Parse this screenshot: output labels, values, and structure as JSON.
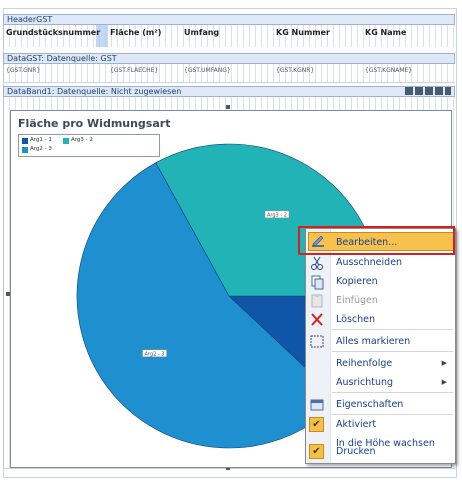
{
  "header_band": {
    "title": "HeaderGST",
    "columns": [
      "Grundstücksnummer",
      "Fläche (m²)",
      "Umfang",
      "KG Nummer",
      "KG Name"
    ]
  },
  "data_band": {
    "title": "DataGST: Datenquelle: GST",
    "fields": [
      "{GST.GNR}",
      "{GST.FLAECHE}",
      "{GST.UMFANG}",
      "{GST.KGNR}",
      "{GST.KGNAME}"
    ]
  },
  "data_band1": {
    "title": "DataBand1: Datenquelle: Nicht zugewiesen"
  },
  "chart_data": {
    "type": "pie",
    "title": "Fläche pro Widmungsart",
    "legend": [
      "Arg1 - 1",
      "Arg3 - 2",
      "Arg2 - 3"
    ],
    "slices": [
      {
        "label": "Arg1 - 1",
        "value": 0.12,
        "color": "#0f56a8"
      },
      {
        "label": "Arg2 - 3",
        "value": 0.55,
        "color": "#1e90d0",
        "callout": "Arg2 - 3"
      },
      {
        "label": "Arg3 - 2",
        "value": 0.33,
        "color": "#22b3b6",
        "callout": "Arg3 - 2"
      }
    ]
  },
  "context_menu": {
    "items": [
      {
        "label": "Bearbeiten...",
        "icon": "edit-icon",
        "state": "highlighted"
      },
      {
        "label": "Ausschneiden",
        "icon": "scissors-icon"
      },
      {
        "label": "Kopieren",
        "icon": "copy-icon"
      },
      {
        "label": "Einfügen",
        "icon": "paste-icon",
        "state": "disabled"
      },
      {
        "label": "Löschen",
        "icon": "delete-icon"
      },
      {
        "label": "Alles markieren",
        "icon": "select-all-icon"
      },
      {
        "label": "Reihenfolge",
        "has_submenu": true
      },
      {
        "label": "Ausrichtung",
        "has_submenu": true
      },
      {
        "label": "Eigenschaften",
        "icon": "properties-icon"
      },
      {
        "label": "Aktiviert",
        "checked": true
      },
      {
        "label": "In die Höhe wachsen"
      },
      {
        "label": "Drucken",
        "checked": true
      }
    ],
    "highlight_color": "#f6c14d",
    "annotation_color": "#d42020"
  }
}
